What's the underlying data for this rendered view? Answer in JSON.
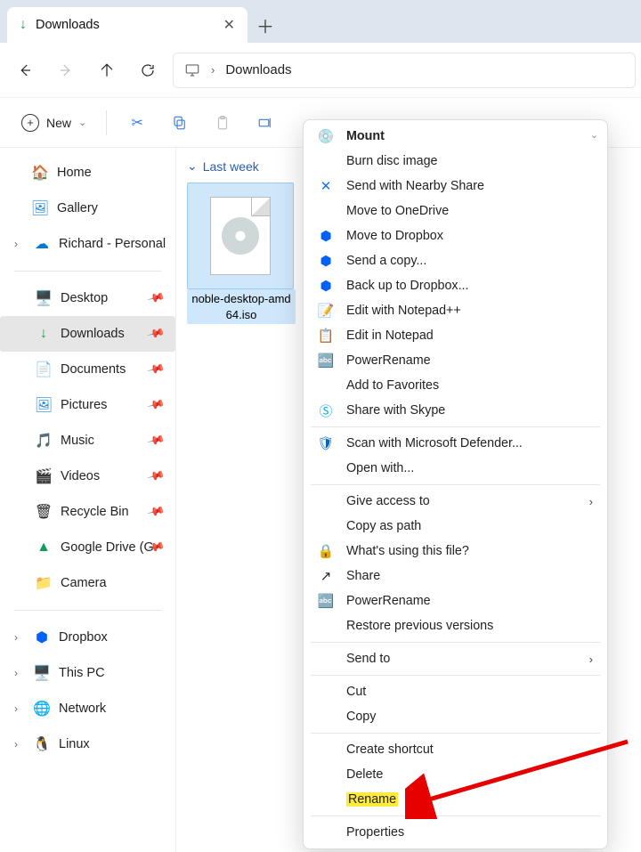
{
  "tab": {
    "title": "Downloads"
  },
  "address": {
    "path": "Downloads"
  },
  "toolbar": {
    "new_label": "New"
  },
  "sidebar": {
    "home": "Home",
    "gallery": "Gallery",
    "onedrive": "Richard - Personal",
    "quick": [
      {
        "label": "Desktop",
        "icon": "desktop"
      },
      {
        "label": "Downloads",
        "icon": "downloads",
        "active": true
      },
      {
        "label": "Documents",
        "icon": "documents"
      },
      {
        "label": "Pictures",
        "icon": "pictures"
      },
      {
        "label": "Music",
        "icon": "music"
      },
      {
        "label": "Videos",
        "icon": "videos"
      },
      {
        "label": "Recycle Bin",
        "icon": "recycle"
      },
      {
        "label": "Google Drive (G",
        "icon": "gdrive"
      },
      {
        "label": "Camera",
        "icon": "folder"
      }
    ],
    "locations": [
      {
        "label": "Dropbox",
        "icon": "dropbox"
      },
      {
        "label": "This PC",
        "icon": "pc"
      },
      {
        "label": "Network",
        "icon": "network"
      },
      {
        "label": "Linux",
        "icon": "linux"
      }
    ]
  },
  "content": {
    "group_header": "Last week",
    "files": [
      {
        "name": "noble-desktop-amd64.iso"
      }
    ]
  },
  "context_menu": {
    "sections": [
      [
        {
          "label": "Mount",
          "bold": true,
          "icon": "disc"
        },
        {
          "label": "Burn disc image"
        },
        {
          "label": "Send with Nearby Share",
          "icon": "nearby"
        },
        {
          "label": "Move to OneDrive"
        },
        {
          "label": "Move to Dropbox",
          "icon": "dropbox"
        },
        {
          "label": "Send a copy...",
          "icon": "dropbox"
        },
        {
          "label": "Back up to Dropbox...",
          "icon": "dropbox"
        },
        {
          "label": "Edit with Notepad++",
          "icon": "npp"
        },
        {
          "label": "Edit in Notepad",
          "icon": "notepad"
        },
        {
          "label": "PowerRename",
          "icon": "powerrename"
        },
        {
          "label": "Add to Favorites"
        },
        {
          "label": "Share with Skype",
          "icon": "skype"
        }
      ],
      [
        {
          "label": "Scan with Microsoft Defender...",
          "icon": "shield"
        },
        {
          "label": "Open with..."
        }
      ],
      [
        {
          "label": "Give access to",
          "submenu": true
        },
        {
          "label": "Copy as path"
        },
        {
          "label": "What's using this file?",
          "icon": "lock"
        },
        {
          "label": "Share",
          "icon": "share"
        },
        {
          "label": "PowerRename",
          "icon": "powerrename"
        },
        {
          "label": "Restore previous versions"
        }
      ],
      [
        {
          "label": "Send to",
          "submenu": true
        }
      ],
      [
        {
          "label": "Cut"
        },
        {
          "label": "Copy"
        }
      ],
      [
        {
          "label": "Create shortcut"
        },
        {
          "label": "Delete"
        },
        {
          "label": "Rename",
          "highlight": true
        }
      ],
      [
        {
          "label": "Properties"
        }
      ]
    ]
  }
}
